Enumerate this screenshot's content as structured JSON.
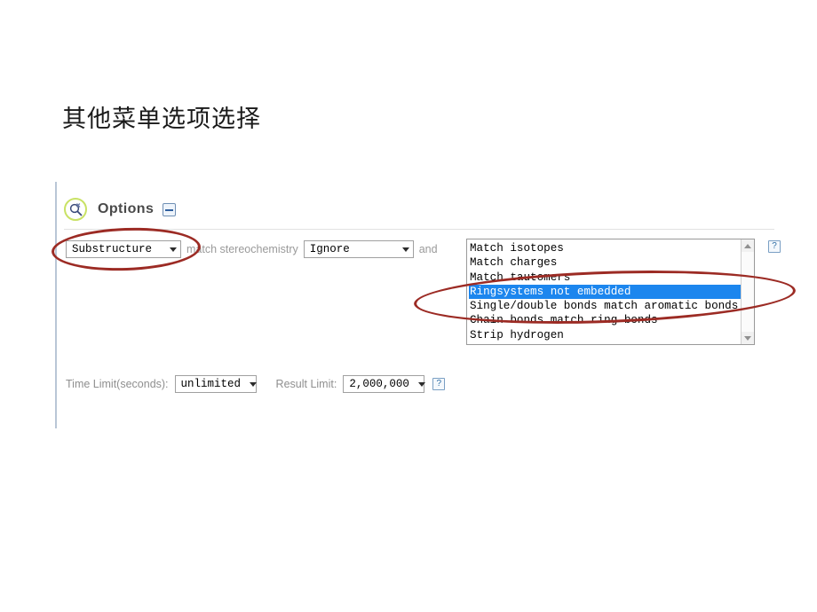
{
  "slide": {
    "title": "其他菜单选项选择"
  },
  "panel": {
    "header": {
      "icon": "query-magnifier-icon",
      "label": "Options",
      "collapse_icon": "collapse-minus-icon"
    },
    "query_row": {
      "search_type": {
        "value": "Substructure",
        "icon": "chevron-down-icon"
      },
      "stereo_label": "match stereochemistry",
      "stereochemistry": {
        "value": "Ignore",
        "icon": "chevron-down-icon"
      },
      "conjunction": "and",
      "help_icon": "?"
    },
    "options_list": {
      "items": [
        {
          "label": "Match isotopes",
          "selected": false
        },
        {
          "label": "Match charges",
          "selected": false
        },
        {
          "label": "Match tautomers",
          "selected": false
        },
        {
          "label": "Ringsystems not embedded",
          "selected": true
        },
        {
          "label": "Single/double bonds match aromatic bonds",
          "selected": false
        },
        {
          "label": "Chain bonds match ring bonds",
          "selected": false
        },
        {
          "label": "Strip hydrogen",
          "selected": false
        }
      ],
      "scrollbar": {
        "up_icon": "scroll-up-arrow-icon",
        "down_icon": "scroll-down-arrow-icon"
      },
      "selected_value": "Ringsystems not embedded",
      "selection_color": "#1c86ee"
    },
    "limits_row": {
      "time_limit_label": "Time Limit(seconds):",
      "time_limit": {
        "value": "unlimited",
        "icon": "chevron-down-icon"
      },
      "result_limit_label": "Result Limit:",
      "result_limit": {
        "value": "2,000,000",
        "icon": "chevron-down-icon"
      },
      "help_icon": "?"
    }
  },
  "annotations": {
    "color": "#9c2b24",
    "ellipse_search_type": "highlight-substructure-dropdown",
    "ellipse_selected_option": "highlight-ringsystems-not-embedded-row"
  }
}
